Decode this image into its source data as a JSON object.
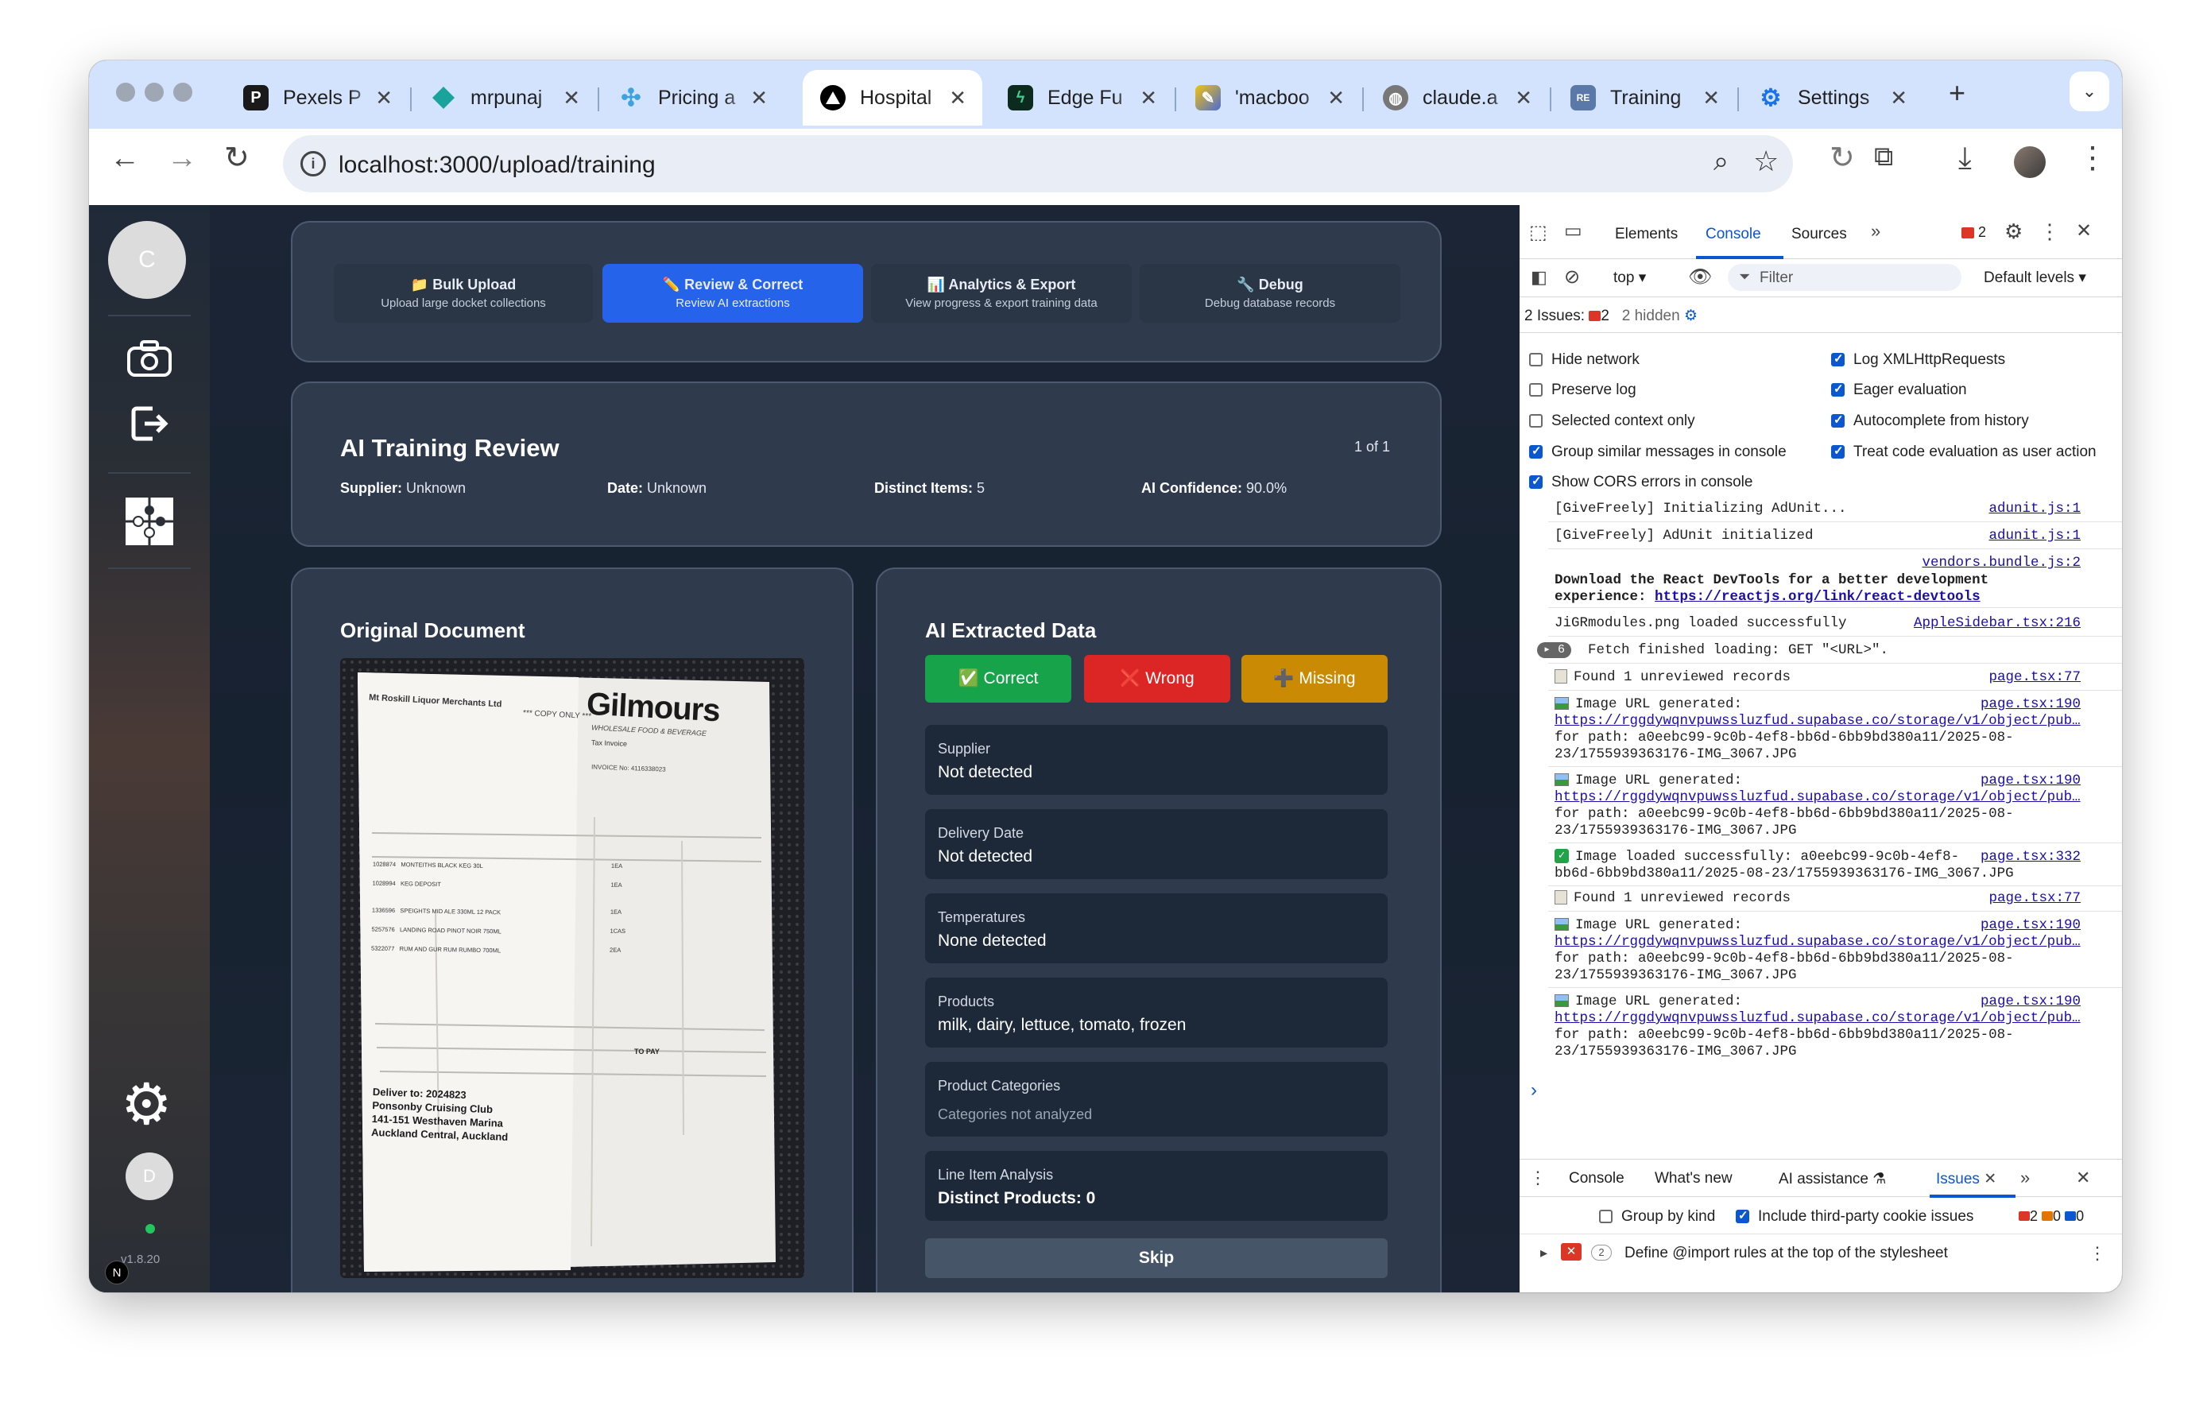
{
  "browser": {
    "tabs": [
      {
        "title": "Pexels P",
        "icon": "pexels-icon",
        "color": "#1a1a1a"
      },
      {
        "title": "mrpunaj",
        "icon": "diamond-icon",
        "color": "#1aa39a"
      },
      {
        "title": "Pricing a",
        "icon": "sparkle-icon",
        "color": "#3aa3e0"
      },
      {
        "title": "Hospital",
        "icon": "triangle-logo-icon",
        "color": "#000000"
      },
      {
        "title": "Edge Fu",
        "icon": "bolt-icon",
        "color": "#0c7a4a"
      },
      {
        "title": "'macboo",
        "icon": "pencil-icon",
        "color": "#4a6cd4"
      },
      {
        "title": "claude.a",
        "icon": "globe-icon",
        "color": "#6a6a6a"
      },
      {
        "title": "Training",
        "icon": "repo-icon",
        "color": "#5a78a8"
      },
      {
        "title": "Settings",
        "icon": "gear-icon",
        "color": "#1a73e8"
      }
    ],
    "url": "localhost:3000/upload/training"
  },
  "app": {
    "user_initial": "C",
    "bottom_initial": "D",
    "version": "v1.8.20",
    "nav": [
      {
        "title": "📁 Bulk Upload",
        "subtitle": "Upload large docket collections"
      },
      {
        "title": "✏️ Review & Correct",
        "subtitle": "Review AI extractions"
      },
      {
        "title": "📊 Analytics & Export",
        "subtitle": "View progress & export training data"
      },
      {
        "title": "🔧 Debug",
        "subtitle": "Debug database records"
      }
    ],
    "review": {
      "title": "AI Training Review",
      "counter": "1 of 1",
      "supplier_label": "Supplier:",
      "supplier_value": "Unknown",
      "date_label": "Date:",
      "date_value": "Unknown",
      "items_label": "Distinct Items:",
      "items_value": "5",
      "confidence_label": "AI Confidence:",
      "confidence_value": "90.0%"
    },
    "original_title": "Original Document",
    "receipt": {
      "logo": "Gilmours",
      "logo_sub": "WHOLESALE FOOD & BEVERAGE",
      "sender": "Mt Roskill Liquor Merchants Ltd",
      "copy_only": "*** COPY ONLY ***",
      "doc_type": "Tax Invoice",
      "invoice_no": "INVOICE No: 4116338023",
      "lines": [
        {
          "code": "1028874",
          "desc": "MONTEITHS BLACK KEG 30L",
          "qty": "1EA"
        },
        {
          "code": "1028994",
          "desc": "KEG DEPOSIT",
          "qty": "1EA"
        },
        {
          "code": "1336596",
          "desc": "SPEIGHTS MID ALE 330ML 12 PACK",
          "qty": "1EA"
        },
        {
          "code": "5257576",
          "desc": "LANDING ROAD PINOT NOIR 750ML",
          "qty": "1CAS"
        },
        {
          "code": "5322077",
          "desc": "RUM AND GUR RUM RUMBO 700ML",
          "qty": "2EA"
        }
      ],
      "to_pay": "TO PAY",
      "deliver_to": "Deliver to: 2024823",
      "deliver_lines": [
        "Ponsonby Cruising Club",
        "141-151 Westhaven Marina",
        "Auckland Central, Auckland"
      ]
    },
    "extracted": {
      "title": "AI Extracted Data",
      "buttons": {
        "correct": "✅ Correct",
        "wrong": "❌ Wrong",
        "missing": "➕ Missing"
      },
      "fields": [
        {
          "label": "Supplier",
          "value": "Not detected",
          "muted": false
        },
        {
          "label": "Delivery Date",
          "value": "Not detected",
          "muted": false
        },
        {
          "label": "Temperatures",
          "value": "None detected",
          "muted": false
        },
        {
          "label": "Products",
          "value": "milk, dairy, lettuce, tomato, frozen",
          "muted": false
        },
        {
          "label": "Product Categories",
          "value": "Categories not analyzed",
          "muted": true
        },
        {
          "label": "Line Item Analysis",
          "value": "Distinct Products: 0",
          "muted": false
        }
      ],
      "skip": "Skip"
    }
  },
  "devtools": {
    "tabs": [
      "Elements",
      "Console",
      "Sources"
    ],
    "issue_count": "2",
    "context": "top",
    "filter_placeholder": "Filter",
    "levels": "Default levels",
    "issues_line": "2 Issues:",
    "issues_badge": "2",
    "hidden": "2 hidden",
    "options_left": [
      {
        "label": "Hide network",
        "checked": false
      },
      {
        "label": "Preserve log",
        "checked": false
      },
      {
        "label": "Selected context only",
        "checked": false
      },
      {
        "label": "Group similar messages in console",
        "checked": true
      },
      {
        "label": "Show CORS errors in console",
        "checked": true
      }
    ],
    "options_right": [
      {
        "label": "Log XMLHttpRequests",
        "checked": true
      },
      {
        "label": "Eager evaluation",
        "checked": true
      },
      {
        "label": "Autocomplete from history",
        "checked": true
      },
      {
        "label": "Treat code evaluation as user action",
        "checked": true
      }
    ],
    "logs": {
      "l1": "[GiveFreely] Initializing AdUnit...",
      "l1_src": "adunit.js:1",
      "l2": "[GiveFreely] AdUnit initialized",
      "l2_src": "adunit.js:1",
      "l3_src": "vendors.bundle.js:2",
      "l3a": "Download the React DevTools for a better development",
      "l3b": "experience: ",
      "l3_link": "https://reactjs.org/link/react-devtools",
      "l4": "JiGRmodules.png loaded successfully",
      "l4_src": "AppleSidebar.tsx:216",
      "l5_count": "6",
      "l5": "Fetch finished loading: GET \"<URL>\".",
      "l6": "Found 1 unreviewed records",
      "l6_src": "page.tsx:77",
      "img_label": "Image URL generated:",
      "img_src": "page.tsx:190",
      "img_link": "https://rggdywqnvpuwssluzfud.supabase.co/storage/v1/object/pub…",
      "img_path1": "for path: a0eebc99-9c0b-4ef8-bb6d-6bb9bd380a11/2025-08-",
      "img_path2": "23/1755939363176-IMG_3067.JPG",
      "ok1": "Image loaded successfully: a0eebc99-9c0b-4ef8-",
      "ok_src": "page.tsx:332",
      "ok2": "bb6d-6bb9bd380a11/2025-08-23/1755939363176-IMG_3067.JPG",
      "found2": "Found 1 unreviewed records",
      "found2_src": "page.tsx:77"
    },
    "prompt": "›",
    "drawer_tabs": [
      "Console",
      "What's new",
      "AI assistance",
      "Issues"
    ],
    "drawer_options": {
      "group": "Group by kind",
      "third_party": "Include third-party cookie issues"
    },
    "drawer_counts": {
      "errors": "2",
      "warnings": "0",
      "info": "0"
    },
    "issue_item": {
      "count": "2",
      "text": "Define @import rules at the top of the stylesheet"
    }
  }
}
